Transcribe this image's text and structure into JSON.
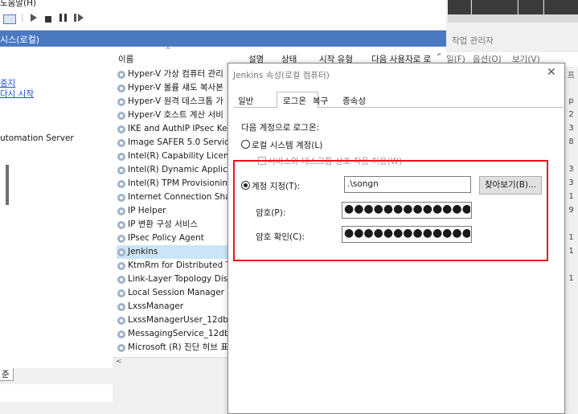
{
  "menubar": {
    "help": "도움말(H)"
  },
  "toolbar": {
    "icons": [
      "console-icon",
      "play-icon",
      "stop-icon",
      "pause-icon",
      "resume-icon"
    ]
  },
  "left": {
    "header": "시스(로컬)",
    "link_stop": "중지",
    "link_restart": "다시 시작",
    "description": "utomation Server",
    "tab_standard": "준"
  },
  "list": {
    "column_name": "이름",
    "services": [
      "Hyper-V 가상 컴퓨터 관리",
      "Hyper-V 볼륨 섀도 복사본",
      "Hyper-V 원격 데스크톱 가",
      "Hyper-V 호스트 계산 서비",
      "IKE and AuthIP IPsec Key",
      "Image SAFER 5.0 Service",
      "Intel(R) Capability Licensi",
      "Intel(R) Dynamic Applica",
      "Intel(R) TPM Provisioning",
      "Internet Connection Shar",
      "IP Helper",
      "IP 변환 구성 서비스",
      "IPsec Policy Agent",
      "Jenkins",
      "KtmRm for Distributed Tr",
      "Link-Layer Topology Disc",
      "Local Session Manager",
      "LxssManager",
      "LxssManagerUser_12db4",
      "MessagingService_12db4",
      "Microsoft (R) 진단 허브 표"
    ],
    "selected_index": 13
  },
  "header_cols": {
    "desc": "설명",
    "status": "상태",
    "startup": "시작 유형",
    "logon": "다음 사용자로 로"
  },
  "task_manager": {
    "title": "작업 관리자",
    "menu_file": "일(F)",
    "menu_options": "옵션(O)",
    "menu_view": "보기(V)",
    "edge_values": [
      "프",
      "p",
      "2",
      "3",
      "8",
      "3",
      "3",
      "1",
      "9",
      "1",
      "1",
      "1"
    ]
  },
  "dialog": {
    "title": "Jenkins 속성(로컬 컴퓨터)",
    "tabs": [
      "일반",
      "로그온",
      "복구",
      "종속성"
    ],
    "active_tab": "로그온",
    "logon_as": "다음 계정으로 로그온:",
    "local_system": "로컬 시스템 계정(L)",
    "allow_desktop": "서비스와 데스크톱 상호 작용 허용(W)",
    "this_account": "계정 지정(T):",
    "account_value": ".\\songn",
    "browse": "찾아보기(B)...",
    "password_label": "암호(P):",
    "password_value": "●●●●●●●●●●●●●●●●",
    "confirm_label": "암호 확인(C):",
    "confirm_value": "●●●●●●●●●●●●●●●●",
    "highlight_color": "#e8141b"
  }
}
